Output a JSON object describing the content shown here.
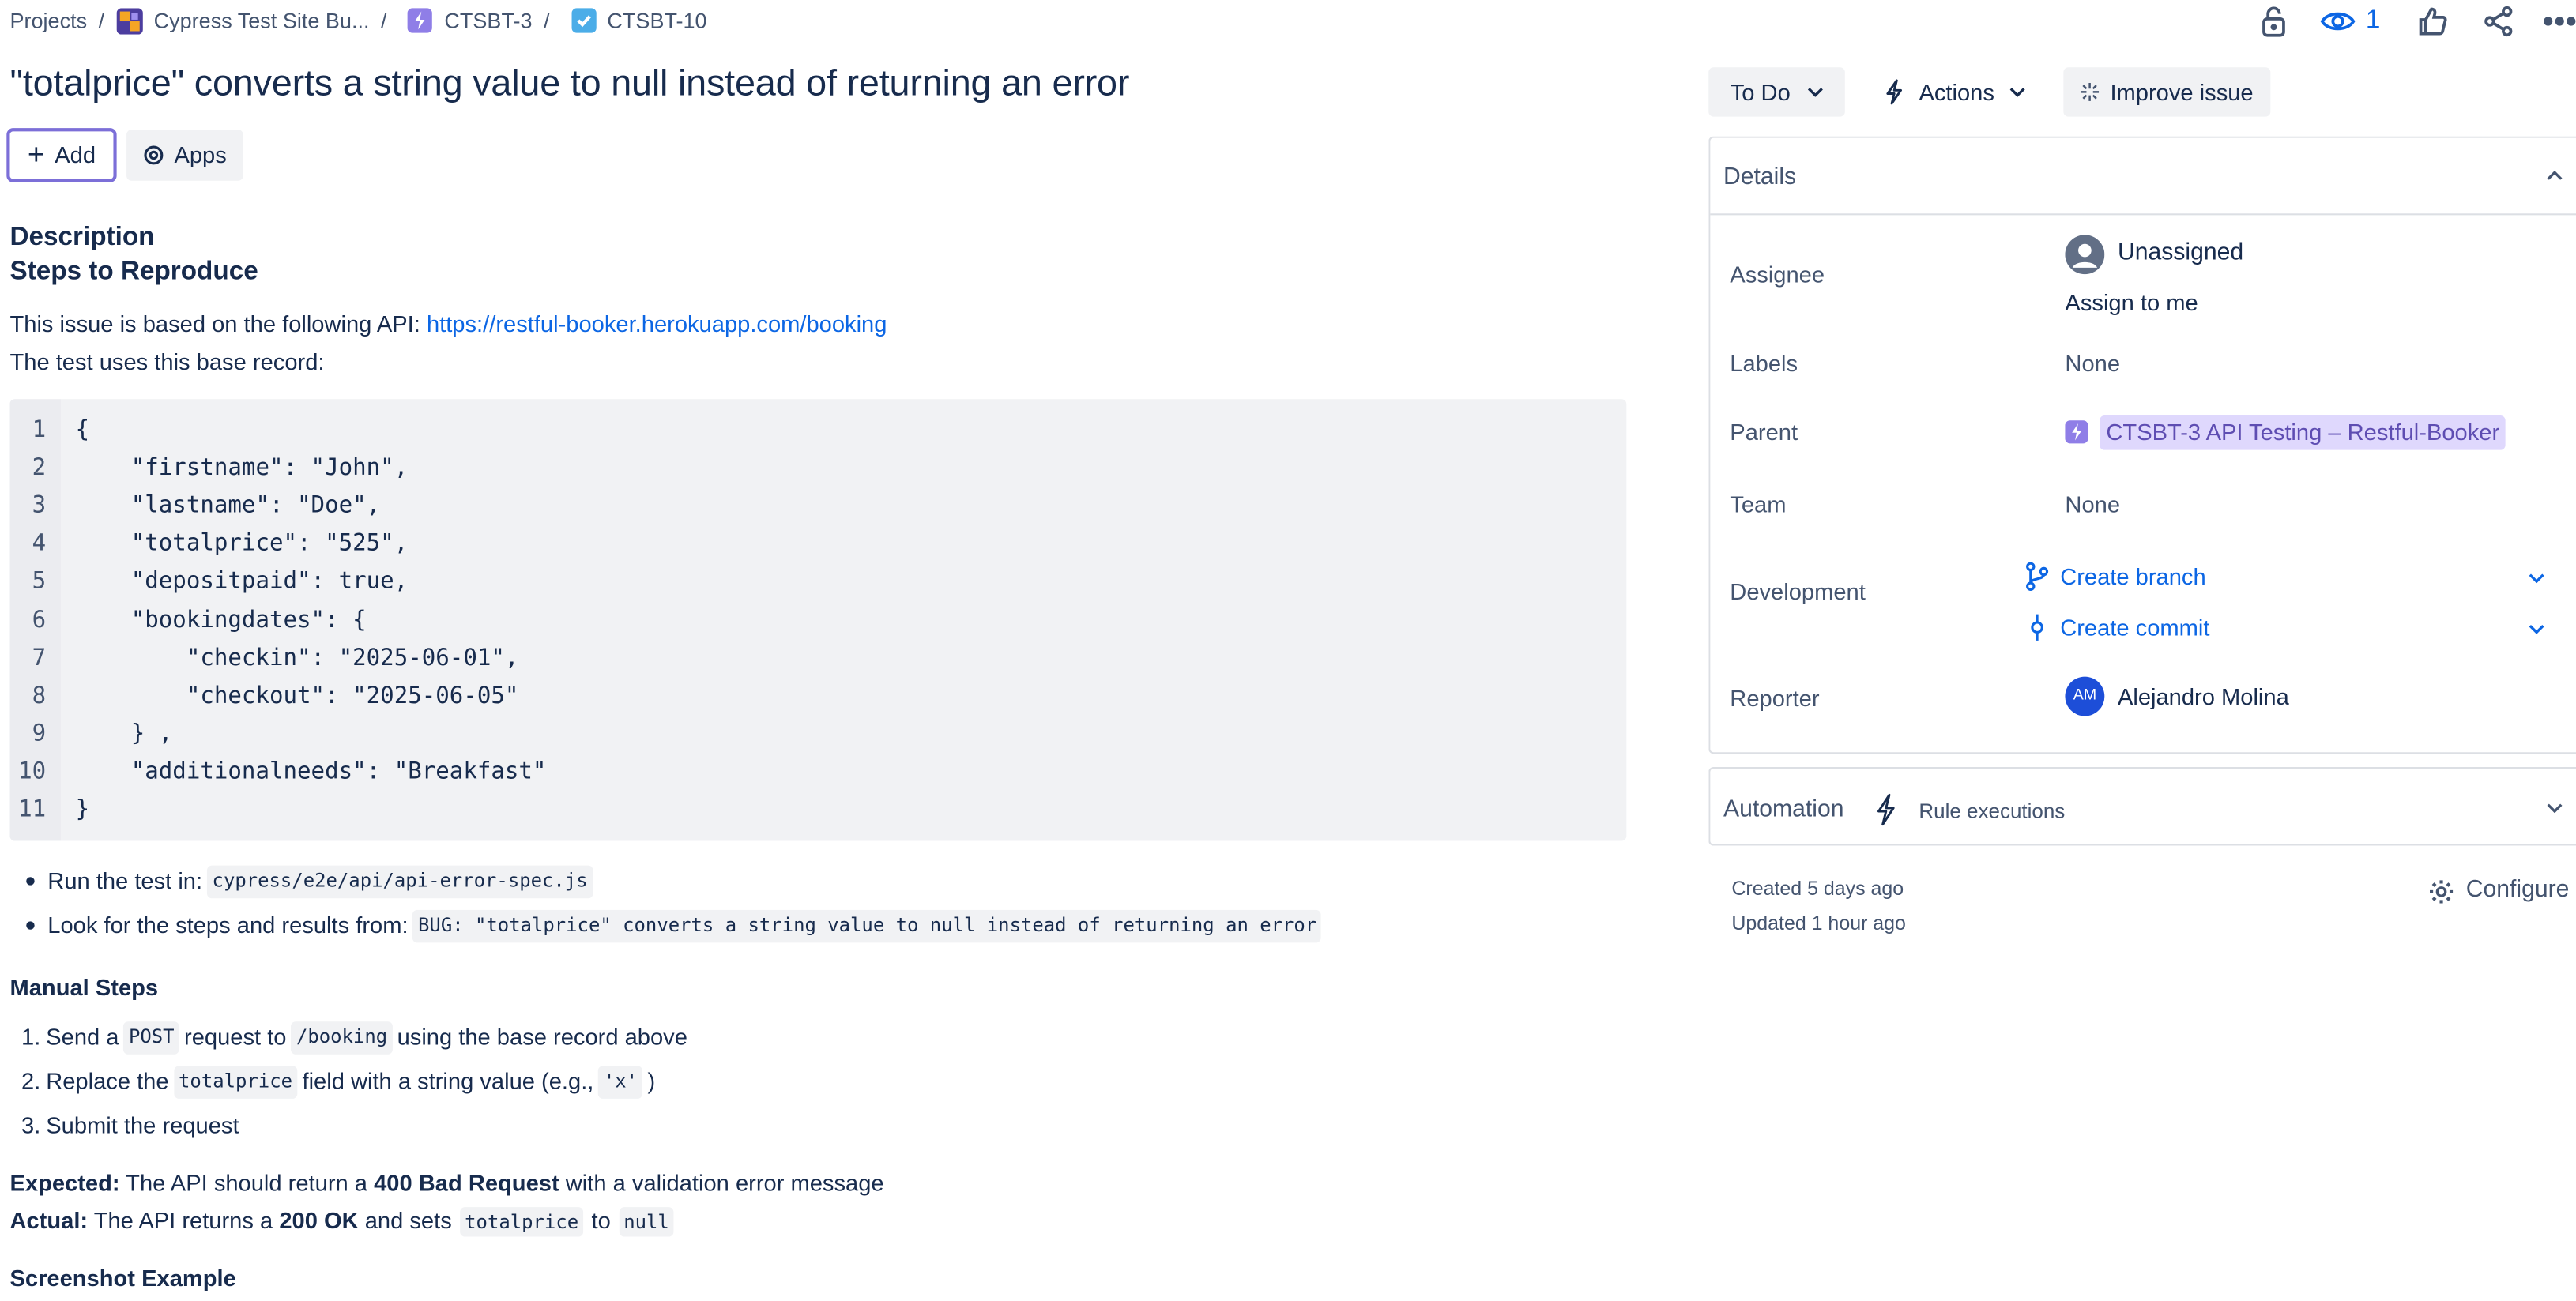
{
  "breadcrumb": {
    "projects": "Projects",
    "project": "Cypress Test Site Bu...",
    "epic": "CTSBT-3",
    "issue": "CTSBT-10",
    "separator": "/"
  },
  "toolbar": {
    "watch_count": "1"
  },
  "issue": {
    "title": "\"totalprice\" converts a string value to null instead of returning an error",
    "add_label": "Add",
    "apps_label": "Apps"
  },
  "description": {
    "heading": "Description",
    "steps_heading": "Steps to Reproduce",
    "api_prefix": "This issue is based on the following API: ",
    "api_link": "https://restful-booker.herokuapp.com/booking",
    "base_record_text": "The test uses this base record:",
    "code_lines": [
      {
        "n": "1",
        "text": "{"
      },
      {
        "n": "2",
        "text": "    \"firstname\": \"John\","
      },
      {
        "n": "3",
        "text": "    \"lastname\": \"Doe\","
      },
      {
        "n": "4",
        "text": "    \"totalprice\": \"525\","
      },
      {
        "n": "5",
        "text": "    \"depositpaid\": true,"
      },
      {
        "n": "6",
        "text": "    \"bookingdates\": {"
      },
      {
        "n": "7",
        "text": "        \"checkin\": \"2025-06-01\","
      },
      {
        "n": "8",
        "text": "        \"checkout\": \"2025-06-05\""
      },
      {
        "n": "9",
        "text": "    } ,"
      },
      {
        "n": "10",
        "text": "    \"additionalneeds\": \"Breakfast\""
      },
      {
        "n": "11",
        "text": "}"
      }
    ],
    "bullets": {
      "run_prefix": "Run the test in:",
      "run_code": "cypress/e2e/api/api-error-spec.js",
      "look_prefix": "Look for the steps and results from:",
      "look_code": "BUG: \"totalprice\" converts a string value to null instead of returning an error"
    },
    "manual_heading": "Manual Steps",
    "manual_steps": {
      "s1_num": "1.",
      "s1_a": "Send a",
      "s1_code1": "POST",
      "s1_b": "request to",
      "s1_code2": "/booking",
      "s1_c": "using the base record above",
      "s2_num": "2.",
      "s2_a": "Replace the",
      "s2_code1": "totalprice",
      "s2_b": "field with a string value (e.g.,",
      "s2_code2": "'x'",
      "s2_c": ")",
      "s3_num": "3.",
      "s3_a": "Submit the request"
    },
    "expected_label": "Expected:",
    "expected_a": " The API should return a ",
    "expected_bold": "400 Bad Request",
    "expected_b": " with a validation error message",
    "actual_label": "Actual:",
    "actual_a": " The API returns a ",
    "actual_bold": "200 OK",
    "actual_b": " and sets ",
    "actual_code1": "totalprice",
    "actual_c": " to ",
    "actual_code2": "null",
    "screenshot_heading": "Screenshot Example"
  },
  "sidebar": {
    "status_label": "To Do",
    "actions_label": "Actions",
    "improve_label": "Improve issue",
    "details_title": "Details",
    "assignee_label": "Assignee",
    "assignee_value": "Unassigned",
    "assign_to_me": "Assign to me",
    "labels_label": "Labels",
    "labels_value": "None",
    "parent_label": "Parent",
    "parent_value": "CTSBT-3 API Testing – Restful-Booker",
    "team_label": "Team",
    "team_value": "None",
    "development_label": "Development",
    "create_branch": "Create branch",
    "create_commit": "Create commit",
    "reporter_label": "Reporter",
    "reporter_initials": "AM",
    "reporter_name": "Alejandro Molina",
    "automation_title": "Automation",
    "rule_executions": "Rule executions",
    "created": "Created 5 days ago",
    "updated": "Updated 1 hour ago",
    "configure_label": "Configure"
  },
  "colors": {
    "link": "#0c66e4",
    "epic_purple": "#8f7ee7",
    "parent_bg": "#dfd8fd",
    "avatar_blue": "#1d4ed8",
    "focus_border": "#7c6fd8"
  }
}
